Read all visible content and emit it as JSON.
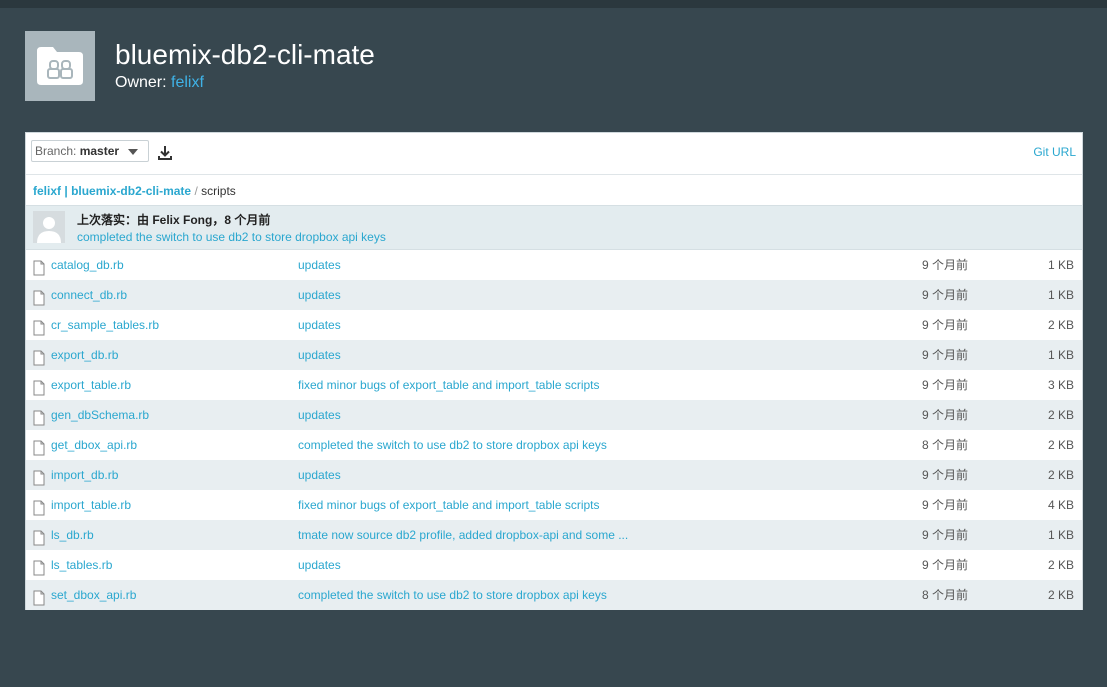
{
  "repo": {
    "title": "bluemix-db2-cli-mate",
    "owner_label": "Owner:",
    "owner": "felixf"
  },
  "toolbar": {
    "branch_label": "Branch:",
    "branch_value": "master",
    "git_url": "Git URL"
  },
  "breadcrumb": {
    "user": "felixf",
    "separator": "|",
    "repo": "bluemix-db2-cli-mate",
    "folder": "scripts"
  },
  "commit": {
    "title": "上次落实：由 Felix Fong，8 个月前",
    "message": "completed the switch to use db2 to store dropbox api keys"
  },
  "files": [
    {
      "name": "catalog_db.rb",
      "message": "updates",
      "age": "9 个月前",
      "size": "1 KB"
    },
    {
      "name": "connect_db.rb",
      "message": "updates",
      "age": "9 个月前",
      "size": "1 KB"
    },
    {
      "name": "cr_sample_tables.rb",
      "message": "updates",
      "age": "9 个月前",
      "size": "2 KB"
    },
    {
      "name": "export_db.rb",
      "message": "updates",
      "age": "9 个月前",
      "size": "1 KB"
    },
    {
      "name": "export_table.rb",
      "message": "fixed minor bugs of export_table and import_table scripts",
      "age": "9 个月前",
      "size": "3 KB"
    },
    {
      "name": "gen_dbSchema.rb",
      "message": "updates",
      "age": "9 个月前",
      "size": "2 KB"
    },
    {
      "name": "get_dbox_api.rb",
      "message": "completed the switch to use db2 to store dropbox api keys",
      "age": "8 个月前",
      "size": "2 KB"
    },
    {
      "name": "import_db.rb",
      "message": "updates",
      "age": "9 个月前",
      "size": "2 KB"
    },
    {
      "name": "import_table.rb",
      "message": "fixed minor bugs of export_table and import_table scripts",
      "age": "9 个月前",
      "size": "4 KB"
    },
    {
      "name": "ls_db.rb",
      "message": "tmate now source db2 profile, added dropbox-api and some ...",
      "age": "9 个月前",
      "size": "1 KB"
    },
    {
      "name": "ls_tables.rb",
      "message": "updates",
      "age": "9 个月前",
      "size": "2 KB"
    },
    {
      "name": "set_dbox_api.rb",
      "message": "completed the switch to use db2 to store dropbox api keys",
      "age": "8 个月前",
      "size": "2 KB"
    }
  ],
  "icons": {
    "repo": "repo-folder-icon",
    "download": "download-icon",
    "file": "file-icon",
    "avatar": "user-avatar-icon",
    "caret": "chevron-down-icon"
  },
  "colors": {
    "background": "#37474f",
    "link": "#2aa7cf",
    "owner_link": "#3fb2e6",
    "row_alt": "#e8eef1",
    "commit_bg": "#e3ecef"
  }
}
